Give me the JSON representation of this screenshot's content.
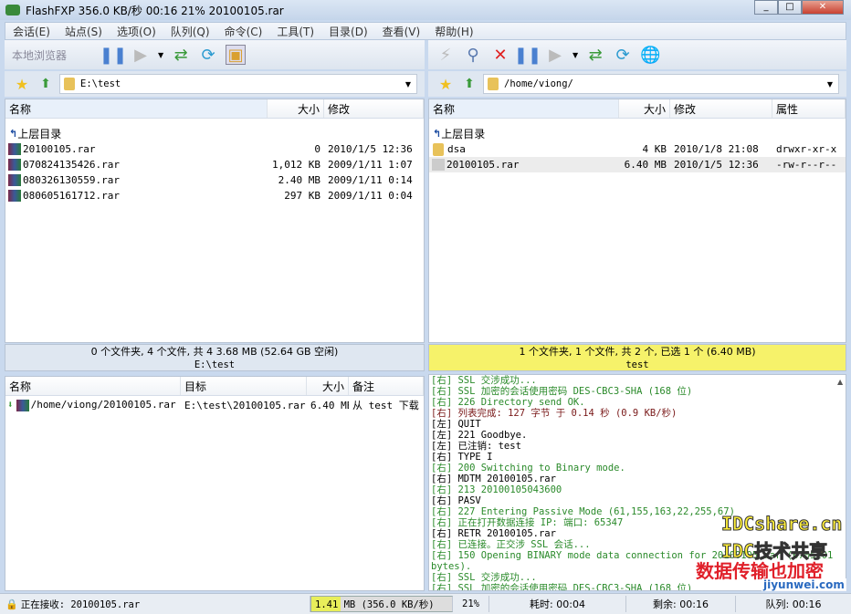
{
  "title": "FlashFXP 356.0 KB/秒 00:16 21% 20100105.rar",
  "menu": [
    "会话(E)",
    "站点(S)",
    "选项(O)",
    "队列(Q)",
    "命令(C)",
    "工具(T)",
    "目录(D)",
    "查看(V)",
    "帮助(H)"
  ],
  "left": {
    "toolbar_label": "本地浏览器",
    "path": "E:\\test",
    "columns": [
      "名称",
      "大小",
      "修改"
    ],
    "parent": "上层目录",
    "files": [
      {
        "name": "20100105.rar",
        "size": "0",
        "modified": "2010/1/5 12:36"
      },
      {
        "name": "070824135426.rar",
        "size": "1,012 KB",
        "modified": "2009/1/11 1:07"
      },
      {
        "name": "080326130559.rar",
        "size": "2.40 MB",
        "modified": "2009/1/11 0:14"
      },
      {
        "name": "080605161712.rar",
        "size": "297 KB",
        "modified": "2009/1/11 0:04"
      }
    ],
    "summary": "0 个文件夹, 4 个文件, 共 4 3.68 MB (52.64 GB 空闲)",
    "summary_path": "E:\\test"
  },
  "right": {
    "path": "/home/viong/",
    "columns": [
      "名称",
      "大小",
      "修改",
      "属性"
    ],
    "parent": "上层目录",
    "files": [
      {
        "name": "dsa",
        "size": "4 KB",
        "modified": "2010/1/8 21:08",
        "attr": "drwxr-xr-x"
      },
      {
        "name": "20100105.rar",
        "size": "6.40 MB",
        "modified": "2010/1/5 12:36",
        "attr": "-rw-r--r--"
      }
    ],
    "summary": "1 个文件夹, 1 个文件, 共 2 个, 已选 1 个 (6.40 MB)",
    "summary_path": "test"
  },
  "queue": {
    "columns": [
      "名称",
      "目标",
      "大小",
      "备注"
    ],
    "items": [
      {
        "name": "/home/viong/20100105.rar",
        "target": "E:\\test\\20100105.rar",
        "size": "6.40 MB",
        "note": "从 test 下载"
      }
    ]
  },
  "log": [
    {
      "t": "[右] SSL 交涉成功...",
      "c": "g"
    },
    {
      "t": "[右] SSL 加密的会话使用密码 DES-CBC3-SHA (168 位)",
      "c": "g"
    },
    {
      "t": "[右] 226 Directory send OK.",
      "c": "g"
    },
    {
      "t": "[右] 列表完成: 127 字节 于 0.14 秒 (0.9 KB/秒)",
      "c": "dr"
    },
    {
      "t": "[左] QUIT",
      "c": "k"
    },
    {
      "t": "[左] 221 Goodbye.",
      "c": "k"
    },
    {
      "t": "[左] 已注销: test",
      "c": "k"
    },
    {
      "t": "[右] TYPE I",
      "c": "k"
    },
    {
      "t": "[右] 200 Switching to Binary mode.",
      "c": "g"
    },
    {
      "t": "[右] MDTM 20100105.rar",
      "c": "k"
    },
    {
      "t": "[右] 213 20100105043600",
      "c": "g"
    },
    {
      "t": "[右] PASV",
      "c": "k"
    },
    {
      "t": "[右] 227 Entering Passive Mode (61,155,163,22,255,67)",
      "c": "g"
    },
    {
      "t": "[右] 正在打开数据连接 IP:                端口: 65347",
      "c": "g"
    },
    {
      "t": "[右] RETR 20100105.rar",
      "c": "k"
    },
    {
      "t": "[右] 已连接。正交涉 SSL 会话...",
      "c": "g"
    },
    {
      "t": "[右] 150 Opening BINARY mode data connection for 20100105.rar (6705201",
      "c": "g"
    },
    {
      "t": "bytes).",
      "c": "g"
    },
    {
      "t": "[右] SSL 交涉成功...",
      "c": "g"
    },
    {
      "t": "[右] SSL 加密的会话使用密码 DES-CBC3-SHA (168 位)",
      "c": "g"
    }
  ],
  "watermark": {
    "line1": "IDCshare.cn",
    "line2": "IDC技术共享",
    "line3": "数据传输也加密",
    "site": "jiyunwei.com"
  },
  "status": {
    "receiving": "正在接收: 20100105.rar",
    "progress_text": "1.41 MB (356.0 KB/秒)",
    "progress_fraction": 0.21,
    "percent": "21%",
    "elapsed": "耗时: 00:04",
    "remaining": "剩余: 00:16",
    "queue": "队列: 00:16"
  }
}
